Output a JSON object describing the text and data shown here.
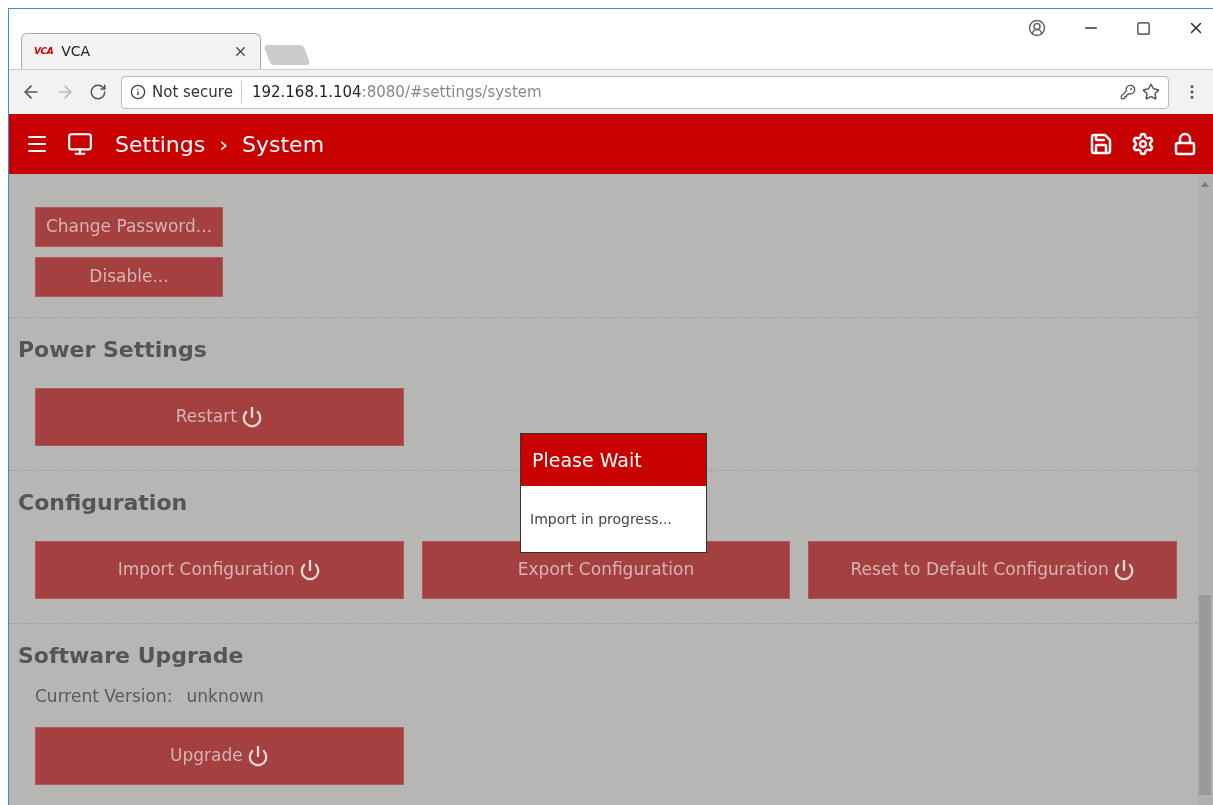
{
  "browser": {
    "tab": {
      "title": "VCA",
      "logo": "VCA",
      "selected": true
    },
    "address": {
      "security": "Not secure",
      "host": "192.168.1.104",
      "rest": ":8080/#settings/system"
    }
  },
  "header": {
    "breadcrumb": [
      "Settings",
      "System"
    ],
    "separator": "›"
  },
  "sections": [
    {
      "kind": "buttons-small",
      "buttons": [
        {
          "label": "Change Password...",
          "power": false
        },
        {
          "label": "Disable...",
          "power": false
        }
      ]
    },
    {
      "kind": "buttons",
      "title": "Power Settings",
      "buttons": [
        {
          "label": "Restart",
          "power": true
        }
      ]
    },
    {
      "kind": "buttons",
      "title": "Configuration",
      "buttons": [
        {
          "label": "Import Configuration",
          "power": true
        },
        {
          "label": "Export Configuration",
          "power": false
        },
        {
          "label": "Reset to Default Configuration",
          "power": true
        }
      ]
    },
    {
      "kind": "version",
      "title": "Software Upgrade",
      "version_label": "Current Version:",
      "version_value": "unknown",
      "buttons": [
        {
          "label": "Upgrade",
          "power": true
        }
      ]
    }
  ],
  "dialog": {
    "title": "Please Wait",
    "message": "Import in progress..."
  }
}
